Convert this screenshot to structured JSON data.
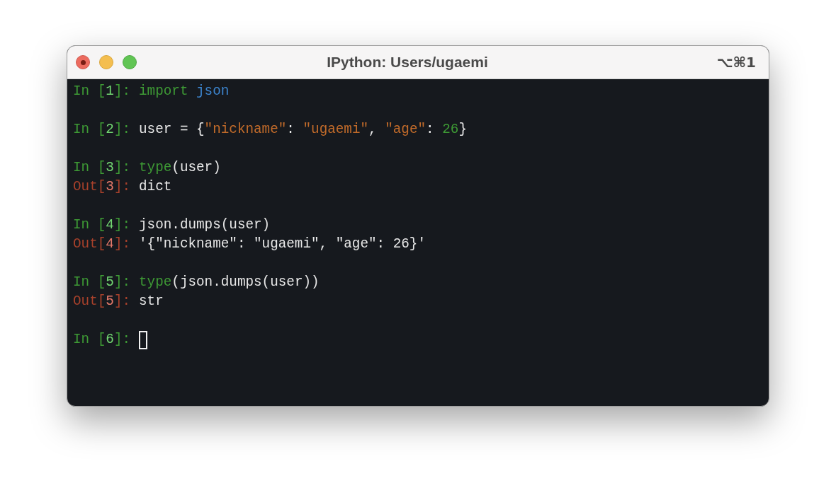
{
  "window": {
    "title": "IPython: Users/ugaemi",
    "shortcut": "⌥⌘1"
  },
  "lines": [
    {
      "kind": "in",
      "prompt": {
        "before": "In [",
        "number": "1",
        "after": "]:"
      },
      "tokens": [
        {
          "kind": "keyword",
          "text": "import"
        },
        {
          "kind": "module",
          "text": " json"
        }
      ]
    },
    {
      "kind": "blank"
    },
    {
      "kind": "in",
      "prompt": {
        "before": "In [",
        "number": "2",
        "after": "]:"
      },
      "tokens": [
        {
          "kind": "plain",
          "text": "user = {"
        },
        {
          "kind": "string",
          "text": "\"nickname\""
        },
        {
          "kind": "plain",
          "text": ": "
        },
        {
          "kind": "string",
          "text": "\"ugaemi\""
        },
        {
          "kind": "plain",
          "text": ", "
        },
        {
          "kind": "string",
          "text": "\"age\""
        },
        {
          "kind": "plain",
          "text": ": "
        },
        {
          "kind": "number",
          "text": "26"
        },
        {
          "kind": "plain",
          "text": "}"
        }
      ]
    },
    {
      "kind": "blank"
    },
    {
      "kind": "in",
      "prompt": {
        "before": "In [",
        "number": "3",
        "after": "]:"
      },
      "tokens": [
        {
          "kind": "builtin",
          "text": "type"
        },
        {
          "kind": "plain",
          "text": "(user)"
        }
      ]
    },
    {
      "kind": "out",
      "prompt": {
        "before": "Out[",
        "number": "3",
        "after": "]:"
      },
      "tokens": [
        {
          "kind": "plain",
          "text": "dict"
        }
      ]
    },
    {
      "kind": "blank"
    },
    {
      "kind": "in",
      "prompt": {
        "before": "In [",
        "number": "4",
        "after": "]:"
      },
      "tokens": [
        {
          "kind": "plain",
          "text": "json.dumps(user)"
        }
      ]
    },
    {
      "kind": "out",
      "prompt": {
        "before": "Out[",
        "number": "4",
        "after": "]:"
      },
      "tokens": [
        {
          "kind": "plain",
          "text": "'{\"nickname\": \"ugaemi\", \"age\": 26}'"
        }
      ]
    },
    {
      "kind": "blank"
    },
    {
      "kind": "in",
      "prompt": {
        "before": "In [",
        "number": "5",
        "after": "]:"
      },
      "tokens": [
        {
          "kind": "builtin",
          "text": "type"
        },
        {
          "kind": "plain",
          "text": "(json.dumps(user))"
        }
      ]
    },
    {
      "kind": "out",
      "prompt": {
        "before": "Out[",
        "number": "5",
        "after": "]:"
      },
      "tokens": [
        {
          "kind": "plain",
          "text": "str"
        }
      ]
    },
    {
      "kind": "blank"
    },
    {
      "kind": "in",
      "prompt": {
        "before": "In [",
        "number": "6",
        "after": "]:"
      },
      "cursor": true
    }
  ]
}
